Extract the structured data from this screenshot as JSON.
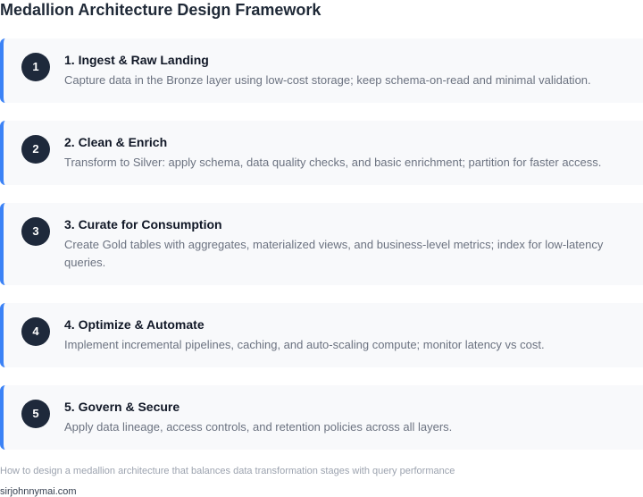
{
  "title": "Medallion Architecture Design Framework",
  "steps": [
    {
      "number": "1",
      "title": "1. Ingest & Raw Landing",
      "description": "Capture data in the Bronze layer using low-cost storage; keep schema-on-read and minimal validation."
    },
    {
      "number": "2",
      "title": "2. Clean & Enrich",
      "description": "Transform to Silver: apply schema, data quality checks, and basic enrichment; partition for faster access."
    },
    {
      "number": "3",
      "title": "3. Curate for Consumption",
      "description": "Create Gold tables with aggregates, materialized views, and business-level metrics; index for low-latency queries."
    },
    {
      "number": "4",
      "title": "4. Optimize & Automate",
      "description": "Implement incremental pipelines, caching, and auto-scaling compute; monitor latency vs cost."
    },
    {
      "number": "5",
      "title": "5. Govern & Secure",
      "description": "Apply data lineage, access controls, and retention policies across all layers."
    }
  ],
  "caption": "How to design a medallion architecture that balances data transformation stages with query performance",
  "site": "sirjohnnymai.com",
  "colors": {
    "accent": "#3b82f6",
    "badge": "#1e293b",
    "card": "#f8f9fb"
  }
}
